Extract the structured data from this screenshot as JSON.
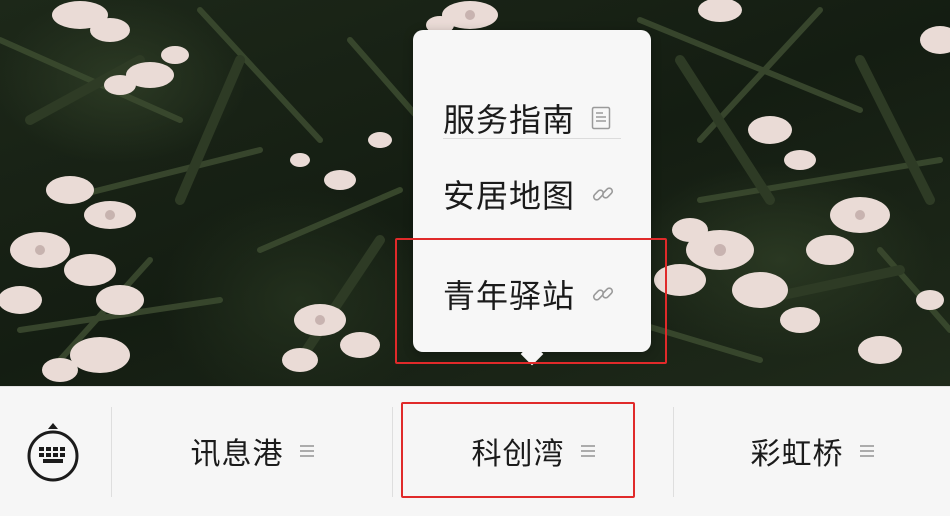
{
  "popup_menu": {
    "items": [
      {
        "label": "服务指南",
        "icon": "document-icon"
      },
      {
        "label": "安居地图",
        "icon": "link-icon"
      },
      {
        "label": "青年驿站",
        "icon": "link-icon"
      }
    ]
  },
  "bottom_bar": {
    "keyboard_icon": "keyboard-icon",
    "tabs": [
      {
        "label": "讯息港",
        "icon": "menu-lines-icon"
      },
      {
        "label": "科创湾",
        "icon": "menu-lines-icon"
      },
      {
        "label": "彩虹桥",
        "icon": "menu-lines-icon"
      }
    ]
  },
  "colors": {
    "highlight": "#e02a2a",
    "bar_background": "#f6f6f6",
    "popup_background": "#f7f7f7",
    "text": "#1b1b1b"
  }
}
